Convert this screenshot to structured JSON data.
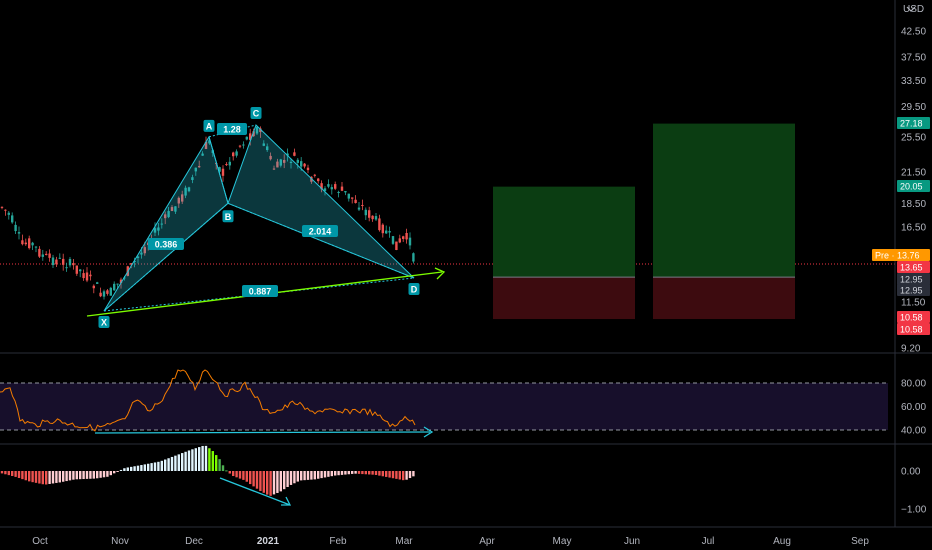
{
  "currency": "USD",
  "price_axis": [
    {
      "v": 42.5,
      "t": "42.50"
    },
    {
      "v": 37.5,
      "t": "37.50"
    },
    {
      "v": 33.5,
      "t": "33.50"
    },
    {
      "v": 29.5,
      "t": "29.50"
    },
    {
      "v": 25.5,
      "t": "25.50"
    },
    {
      "v": 21.5,
      "t": "21.50"
    },
    {
      "v": 18.5,
      "t": "18.50"
    },
    {
      "v": 16.5,
      "t": "16.50"
    },
    {
      "v": 11.5,
      "t": "11.50"
    },
    {
      "v": 9.2,
      "t": "9.20"
    }
  ],
  "price_tags": [
    {
      "v": 27.18,
      "text": "27.18",
      "bg": "#089981",
      "fg": "#ffffff",
      "key": "tp2"
    },
    {
      "v": 20.05,
      "text": "20.05",
      "bg": "#089981",
      "fg": "#ffffff",
      "key": "tp1"
    },
    {
      "v": 13.76,
      "text": "Pre · 13.76",
      "bg": "#ff9800",
      "fg": "#ffffff",
      "key": "premarket"
    },
    {
      "v": 13.65,
      "text": "13.65",
      "bg": "#f23645",
      "fg": "#ffffff",
      "key": "last"
    },
    {
      "v": 12.95,
      "text": "12.95",
      "bg": "#2a2e39",
      "fg": "#d1d4dc",
      "key": "entry-a"
    },
    {
      "v": 12.95,
      "text": "12.95",
      "bg": "#2a2e39",
      "fg": "#d1d4dc",
      "key": "entry-b"
    },
    {
      "v": 10.58,
      "text": "10.58",
      "bg": "#f23645",
      "fg": "#ffffff",
      "key": "stop-a"
    },
    {
      "v": 10.58,
      "text": "10.58",
      "bg": "#f23645",
      "fg": "#ffffff",
      "key": "stop-b"
    }
  ],
  "rsi_axis": [
    {
      "v": 80,
      "t": "80.00"
    },
    {
      "v": 60,
      "t": "60.00"
    },
    {
      "v": 40,
      "t": "40.00"
    }
  ],
  "macd_axis": [
    {
      "v": 0,
      "t": "0.00"
    },
    {
      "v": -1,
      "t": "−1.00"
    }
  ],
  "time_axis": [
    {
      "label": "Oct",
      "bold": false
    },
    {
      "label": "Nov",
      "bold": false
    },
    {
      "label": "Dec",
      "bold": false
    },
    {
      "label": "2021",
      "bold": true
    },
    {
      "label": "Feb",
      "bold": false
    },
    {
      "label": "Mar",
      "bold": false
    },
    {
      "label": "Apr",
      "bold": false
    },
    {
      "label": "May",
      "bold": false
    },
    {
      "label": "Jun",
      "bold": false
    },
    {
      "label": "Jul",
      "bold": false
    },
    {
      "label": "Aug",
      "bold": false
    },
    {
      "label": "Sep",
      "bold": false
    }
  ],
  "pattern": {
    "points": [
      {
        "label": "X",
        "v": 11.0
      },
      {
        "label": "A",
        "v": 25.5
      },
      {
        "label": "B",
        "v": 18.5
      },
      {
        "label": "C",
        "v": 27.0
      },
      {
        "label": "D",
        "v": 12.9
      }
    ],
    "fibs": [
      {
        "label": "0.386",
        "key": "xab"
      },
      {
        "label": "1.28",
        "key": "abc"
      },
      {
        "label": "2.014",
        "key": "bcd"
      },
      {
        "label": "0.887",
        "key": "xad"
      }
    ]
  },
  "positions": [
    {
      "entry": 12.95,
      "target": 20.05,
      "stop": 10.58
    },
    {
      "entry": 12.95,
      "target": 27.18,
      "stop": 10.58
    }
  ],
  "colors": {
    "up": "#26a69a",
    "down": "#ef5350",
    "pattern": "#26c6da",
    "trend": "#7cfc00",
    "rsi": "#f57c00",
    "profit": "#0b3d12",
    "loss": "#3d0b0f"
  }
}
